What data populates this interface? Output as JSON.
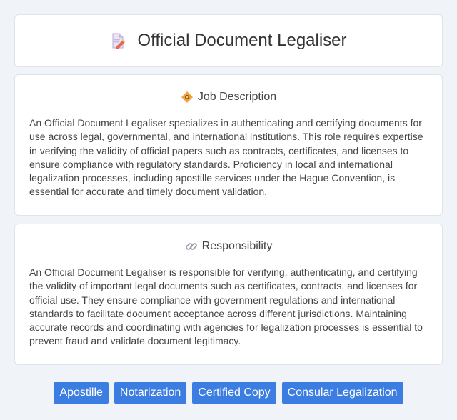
{
  "header": {
    "title": "Official Document Legaliser",
    "icon": "document-pencil-icon"
  },
  "job_description": {
    "title": "Job Description",
    "icon": "diamond-badge-icon",
    "body": "An Official Document Legaliser specializes in authenticating and certifying documents for use across legal, governmental, and international institutions. This role requires expertise in verifying the validity of official papers such as contracts, certificates, and licenses to ensure compliance with regulatory standards. Proficiency in local and international legalization processes, including apostille services under the Hague Convention, is essential for accurate and timely document validation."
  },
  "responsibility": {
    "title": "Responsibility",
    "icon": "link-icon",
    "body": "An Official Document Legaliser is responsible for verifying, authenticating, and certifying the validity of important legal documents such as certificates, contracts, and licenses for official use. They ensure compliance with government regulations and international standards to facilitate document acceptance across different jurisdictions. Maintaining accurate records and coordinating with agencies for legalization processes is essential to prevent fraud and validate document legitimacy."
  },
  "tags": [
    "Apostille",
    "Notarization",
    "Certified Copy",
    "Consular Legalization"
  ],
  "colors": {
    "tag_background": "#3b7de0",
    "page_background": "#f0f3f7"
  }
}
